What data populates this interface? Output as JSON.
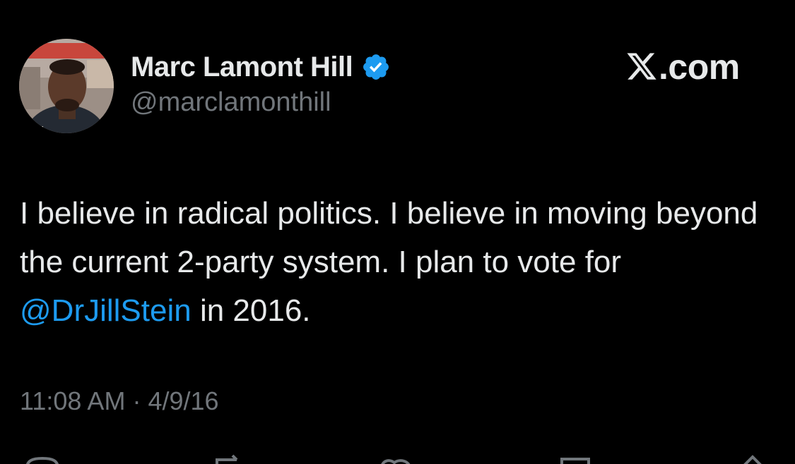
{
  "author": {
    "display_name": "Marc Lamont Hill",
    "handle": "@marclamonthill",
    "avatar_icon": "profile-photo",
    "verified_icon": "verified-badge-icon",
    "verified_color": "#1d9bf0"
  },
  "brand": {
    "icon": "x-logo-icon",
    "text": ".com"
  },
  "tweet": {
    "text_before": "I believe in radical politics. I believe in moving beyond the current 2-party system. I plan to vote for ",
    "mention": "@DrJillStein",
    "text_after": " in 2016.",
    "time": "11:08 AM",
    "separator": "·",
    "date": "4/9/16"
  },
  "actions": [
    "reply-icon",
    "retweet-icon",
    "like-icon",
    "bookmark-icon",
    "share-icon"
  ],
  "colors": {
    "background": "#000000",
    "text": "#e7e9ea",
    "secondary": "#71767b",
    "link": "#1d9bf0"
  }
}
